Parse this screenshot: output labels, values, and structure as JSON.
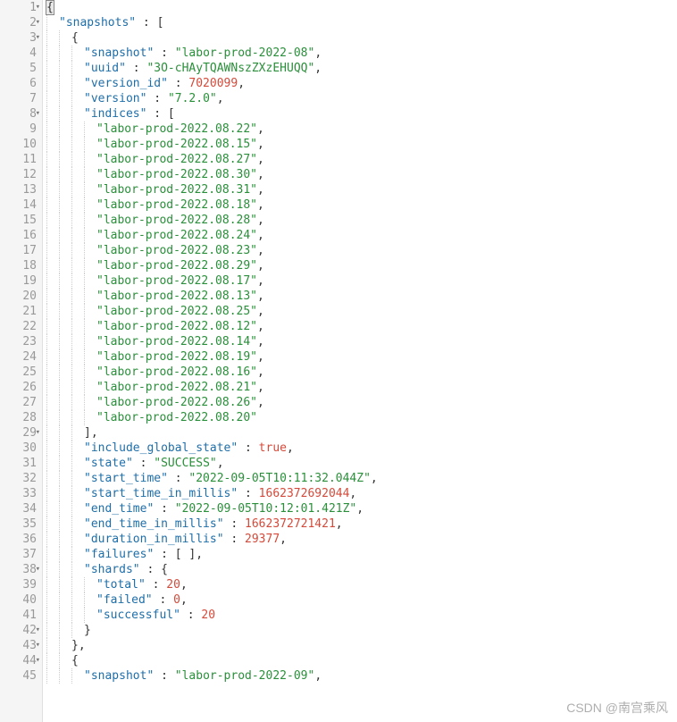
{
  "watermark": "CSDN @南宫乘风",
  "lines": [
    {
      "num": 1,
      "fold": true,
      "indent": 0,
      "code": [
        {
          "t": "brace-h",
          "v": "{"
        }
      ]
    },
    {
      "num": 2,
      "fold": true,
      "indent": 1,
      "code": [
        {
          "t": "key",
          "v": "\"snapshots\""
        },
        {
          "t": "punct",
          "v": " : ["
        }
      ]
    },
    {
      "num": 3,
      "fold": true,
      "indent": 2,
      "code": [
        {
          "t": "punct",
          "v": "{"
        }
      ]
    },
    {
      "num": 4,
      "fold": false,
      "indent": 3,
      "code": [
        {
          "t": "key",
          "v": "\"snapshot\""
        },
        {
          "t": "punct",
          "v": " : "
        },
        {
          "t": "string",
          "v": "\"labor-prod-2022-08\""
        },
        {
          "t": "punct",
          "v": ","
        }
      ]
    },
    {
      "num": 5,
      "fold": false,
      "indent": 3,
      "code": [
        {
          "t": "key",
          "v": "\"uuid\""
        },
        {
          "t": "punct",
          "v": " : "
        },
        {
          "t": "string",
          "v": "\"3O-cHAyTQAWNszZXzEHUQQ\""
        },
        {
          "t": "punct",
          "v": ","
        }
      ]
    },
    {
      "num": 6,
      "fold": false,
      "indent": 3,
      "code": [
        {
          "t": "key",
          "v": "\"version_id\""
        },
        {
          "t": "punct",
          "v": " : "
        },
        {
          "t": "number",
          "v": "7020099"
        },
        {
          "t": "punct",
          "v": ","
        }
      ]
    },
    {
      "num": 7,
      "fold": false,
      "indent": 3,
      "code": [
        {
          "t": "key",
          "v": "\"version\""
        },
        {
          "t": "punct",
          "v": " : "
        },
        {
          "t": "string",
          "v": "\"7.2.0\""
        },
        {
          "t": "punct",
          "v": ","
        }
      ]
    },
    {
      "num": 8,
      "fold": true,
      "indent": 3,
      "code": [
        {
          "t": "key",
          "v": "\"indices\""
        },
        {
          "t": "punct",
          "v": " : ["
        }
      ]
    },
    {
      "num": 9,
      "fold": false,
      "indent": 4,
      "code": [
        {
          "t": "string",
          "v": "\"labor-prod-2022.08.22\""
        },
        {
          "t": "punct",
          "v": ","
        }
      ]
    },
    {
      "num": 10,
      "fold": false,
      "indent": 4,
      "code": [
        {
          "t": "string",
          "v": "\"labor-prod-2022.08.15\""
        },
        {
          "t": "punct",
          "v": ","
        }
      ]
    },
    {
      "num": 11,
      "fold": false,
      "indent": 4,
      "code": [
        {
          "t": "string",
          "v": "\"labor-prod-2022.08.27\""
        },
        {
          "t": "punct",
          "v": ","
        }
      ]
    },
    {
      "num": 12,
      "fold": false,
      "indent": 4,
      "code": [
        {
          "t": "string",
          "v": "\"labor-prod-2022.08.30\""
        },
        {
          "t": "punct",
          "v": ","
        }
      ]
    },
    {
      "num": 13,
      "fold": false,
      "indent": 4,
      "code": [
        {
          "t": "string",
          "v": "\"labor-prod-2022.08.31\""
        },
        {
          "t": "punct",
          "v": ","
        }
      ]
    },
    {
      "num": 14,
      "fold": false,
      "indent": 4,
      "code": [
        {
          "t": "string",
          "v": "\"labor-prod-2022.08.18\""
        },
        {
          "t": "punct",
          "v": ","
        }
      ]
    },
    {
      "num": 15,
      "fold": false,
      "indent": 4,
      "code": [
        {
          "t": "string",
          "v": "\"labor-prod-2022.08.28\""
        },
        {
          "t": "punct",
          "v": ","
        }
      ]
    },
    {
      "num": 16,
      "fold": false,
      "indent": 4,
      "code": [
        {
          "t": "string",
          "v": "\"labor-prod-2022.08.24\""
        },
        {
          "t": "punct",
          "v": ","
        }
      ]
    },
    {
      "num": 17,
      "fold": false,
      "indent": 4,
      "code": [
        {
          "t": "string",
          "v": "\"labor-prod-2022.08.23\""
        },
        {
          "t": "punct",
          "v": ","
        }
      ]
    },
    {
      "num": 18,
      "fold": false,
      "indent": 4,
      "code": [
        {
          "t": "string",
          "v": "\"labor-prod-2022.08.29\""
        },
        {
          "t": "punct",
          "v": ","
        }
      ]
    },
    {
      "num": 19,
      "fold": false,
      "indent": 4,
      "code": [
        {
          "t": "string",
          "v": "\"labor-prod-2022.08.17\""
        },
        {
          "t": "punct",
          "v": ","
        }
      ]
    },
    {
      "num": 20,
      "fold": false,
      "indent": 4,
      "code": [
        {
          "t": "string",
          "v": "\"labor-prod-2022.08.13\""
        },
        {
          "t": "punct",
          "v": ","
        }
      ]
    },
    {
      "num": 21,
      "fold": false,
      "indent": 4,
      "code": [
        {
          "t": "string",
          "v": "\"labor-prod-2022.08.25\""
        },
        {
          "t": "punct",
          "v": ","
        }
      ]
    },
    {
      "num": 22,
      "fold": false,
      "indent": 4,
      "code": [
        {
          "t": "string",
          "v": "\"labor-prod-2022.08.12\""
        },
        {
          "t": "punct",
          "v": ","
        }
      ]
    },
    {
      "num": 23,
      "fold": false,
      "indent": 4,
      "code": [
        {
          "t": "string",
          "v": "\"labor-prod-2022.08.14\""
        },
        {
          "t": "punct",
          "v": ","
        }
      ]
    },
    {
      "num": 24,
      "fold": false,
      "indent": 4,
      "code": [
        {
          "t": "string",
          "v": "\"labor-prod-2022.08.19\""
        },
        {
          "t": "punct",
          "v": ","
        }
      ]
    },
    {
      "num": 25,
      "fold": false,
      "indent": 4,
      "code": [
        {
          "t": "string",
          "v": "\"labor-prod-2022.08.16\""
        },
        {
          "t": "punct",
          "v": ","
        }
      ]
    },
    {
      "num": 26,
      "fold": false,
      "indent": 4,
      "code": [
        {
          "t": "string",
          "v": "\"labor-prod-2022.08.21\""
        },
        {
          "t": "punct",
          "v": ","
        }
      ]
    },
    {
      "num": 27,
      "fold": false,
      "indent": 4,
      "code": [
        {
          "t": "string",
          "v": "\"labor-prod-2022.08.26\""
        },
        {
          "t": "punct",
          "v": ","
        }
      ]
    },
    {
      "num": 28,
      "fold": false,
      "indent": 4,
      "code": [
        {
          "t": "string",
          "v": "\"labor-prod-2022.08.20\""
        }
      ]
    },
    {
      "num": 29,
      "fold": true,
      "indent": 3,
      "code": [
        {
          "t": "punct",
          "v": "],"
        }
      ]
    },
    {
      "num": 30,
      "fold": false,
      "indent": 3,
      "code": [
        {
          "t": "key",
          "v": "\"include_global_state\""
        },
        {
          "t": "punct",
          "v": " : "
        },
        {
          "t": "bool",
          "v": "true"
        },
        {
          "t": "punct",
          "v": ","
        }
      ]
    },
    {
      "num": 31,
      "fold": false,
      "indent": 3,
      "code": [
        {
          "t": "key",
          "v": "\"state\""
        },
        {
          "t": "punct",
          "v": " : "
        },
        {
          "t": "string",
          "v": "\"SUCCESS\""
        },
        {
          "t": "punct",
          "v": ","
        }
      ]
    },
    {
      "num": 32,
      "fold": false,
      "indent": 3,
      "code": [
        {
          "t": "key",
          "v": "\"start_time\""
        },
        {
          "t": "punct",
          "v": " : "
        },
        {
          "t": "string",
          "v": "\"2022-09-05T10:11:32.044Z\""
        },
        {
          "t": "punct",
          "v": ","
        }
      ]
    },
    {
      "num": 33,
      "fold": false,
      "indent": 3,
      "code": [
        {
          "t": "key",
          "v": "\"start_time_in_millis\""
        },
        {
          "t": "punct",
          "v": " : "
        },
        {
          "t": "number",
          "v": "1662372692044"
        },
        {
          "t": "punct",
          "v": ","
        }
      ]
    },
    {
      "num": 34,
      "fold": false,
      "indent": 3,
      "code": [
        {
          "t": "key",
          "v": "\"end_time\""
        },
        {
          "t": "punct",
          "v": " : "
        },
        {
          "t": "string",
          "v": "\"2022-09-05T10:12:01.421Z\""
        },
        {
          "t": "punct",
          "v": ","
        }
      ]
    },
    {
      "num": 35,
      "fold": false,
      "indent": 3,
      "code": [
        {
          "t": "key",
          "v": "\"end_time_in_millis\""
        },
        {
          "t": "punct",
          "v": " : "
        },
        {
          "t": "number",
          "v": "1662372721421"
        },
        {
          "t": "punct",
          "v": ","
        }
      ]
    },
    {
      "num": 36,
      "fold": false,
      "indent": 3,
      "code": [
        {
          "t": "key",
          "v": "\"duration_in_millis\""
        },
        {
          "t": "punct",
          "v": " : "
        },
        {
          "t": "number",
          "v": "29377"
        },
        {
          "t": "punct",
          "v": ","
        }
      ]
    },
    {
      "num": 37,
      "fold": false,
      "indent": 3,
      "code": [
        {
          "t": "key",
          "v": "\"failures\""
        },
        {
          "t": "punct",
          "v": " : [ ],"
        }
      ]
    },
    {
      "num": 38,
      "fold": true,
      "indent": 3,
      "code": [
        {
          "t": "key",
          "v": "\"shards\""
        },
        {
          "t": "punct",
          "v": " : {"
        }
      ]
    },
    {
      "num": 39,
      "fold": false,
      "indent": 4,
      "code": [
        {
          "t": "key",
          "v": "\"total\""
        },
        {
          "t": "punct",
          "v": " : "
        },
        {
          "t": "number",
          "v": "20"
        },
        {
          "t": "punct",
          "v": ","
        }
      ]
    },
    {
      "num": 40,
      "fold": false,
      "indent": 4,
      "code": [
        {
          "t": "key",
          "v": "\"failed\""
        },
        {
          "t": "punct",
          "v": " : "
        },
        {
          "t": "number",
          "v": "0"
        },
        {
          "t": "punct",
          "v": ","
        }
      ]
    },
    {
      "num": 41,
      "fold": false,
      "indent": 4,
      "code": [
        {
          "t": "key",
          "v": "\"successful\""
        },
        {
          "t": "punct",
          "v": " : "
        },
        {
          "t": "number",
          "v": "20"
        }
      ]
    },
    {
      "num": 42,
      "fold": true,
      "indent": 3,
      "code": [
        {
          "t": "punct",
          "v": "}"
        }
      ]
    },
    {
      "num": 43,
      "fold": true,
      "indent": 2,
      "code": [
        {
          "t": "punct",
          "v": "},"
        }
      ]
    },
    {
      "num": 44,
      "fold": true,
      "indent": 2,
      "code": [
        {
          "t": "punct",
          "v": "{"
        }
      ]
    },
    {
      "num": 45,
      "fold": false,
      "indent": 3,
      "code": [
        {
          "t": "key",
          "v": "\"snapshot\""
        },
        {
          "t": "punct",
          "v": " : "
        },
        {
          "t": "string",
          "v": "\"labor-prod-2022-09\""
        },
        {
          "t": "punct",
          "v": ","
        }
      ]
    }
  ]
}
